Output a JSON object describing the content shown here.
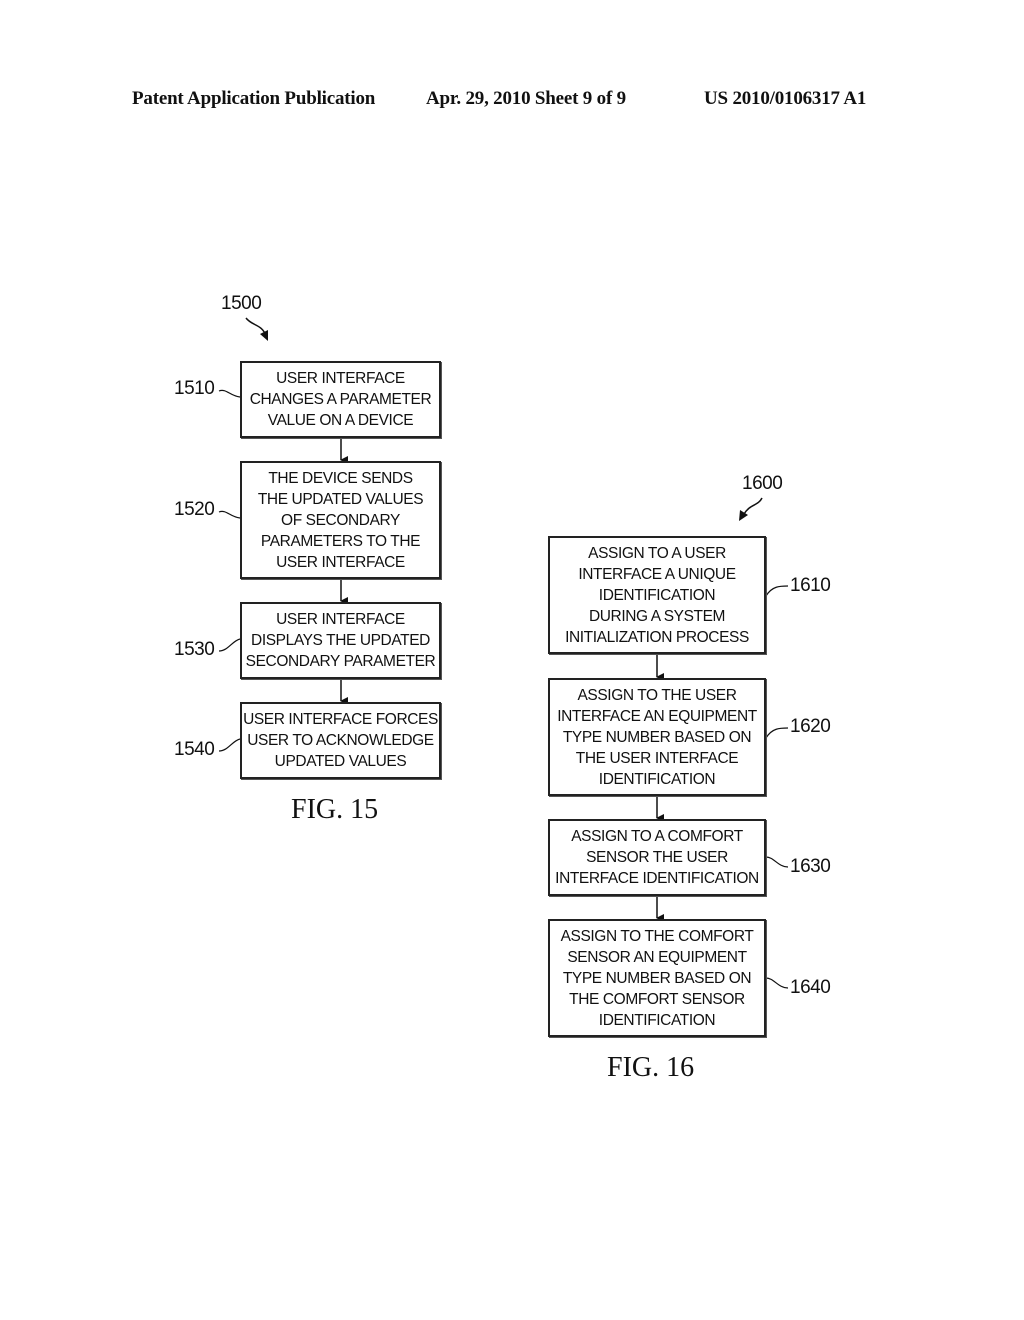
{
  "header": {
    "publication_label": "Patent Application Publication",
    "date_sheet": "Apr. 29, 2010  Sheet 9 of 9",
    "patent_number": "US 2010/0106317 A1"
  },
  "fig15": {
    "ref": "1500",
    "caption": "FIG. 15",
    "steps": [
      {
        "ref": "1510",
        "lines": [
          "USER INTERFACE",
          "CHANGES A PARAMETER",
          "VALUE ON A DEVICE"
        ]
      },
      {
        "ref": "1520",
        "lines": [
          "THE DEVICE SENDS",
          "THE UPDATED VALUES",
          "OF SECONDARY",
          "PARAMETERS TO THE",
          "USER INTERFACE"
        ]
      },
      {
        "ref": "1530",
        "lines": [
          "USER INTERFACE",
          "DISPLAYS THE UPDATED",
          "SECONDARY PARAMETER"
        ]
      },
      {
        "ref": "1540",
        "lines": [
          "USER INTERFACE FORCES",
          "USER TO ACKNOWLEDGE",
          "UPDATED VALUES"
        ]
      }
    ]
  },
  "fig16": {
    "ref": "1600",
    "caption": "FIG. 16",
    "steps": [
      {
        "ref": "1610",
        "lines": [
          "ASSIGN TO A USER",
          "INTERFACE A UNIQUE",
          "IDENTIFICATION",
          "DURING A SYSTEM",
          "INITIALIZATION PROCESS"
        ]
      },
      {
        "ref": "1620",
        "lines": [
          "ASSIGN TO THE USER",
          "INTERFACE AN EQUIPMENT",
          "TYPE NUMBER BASED ON",
          "THE USER INTERFACE",
          "IDENTIFICATION"
        ]
      },
      {
        "ref": "1630",
        "lines": [
          "ASSIGN TO A COMFORT",
          "SENSOR THE USER",
          "INTERFACE IDENTIFICATION"
        ]
      },
      {
        "ref": "1640",
        "lines": [
          "ASSIGN TO THE COMFORT",
          "SENSOR AN EQUIPMENT",
          "TYPE NUMBER BASED ON",
          "THE COMFORT SENSOR",
          "IDENTIFICATION"
        ]
      }
    ]
  }
}
